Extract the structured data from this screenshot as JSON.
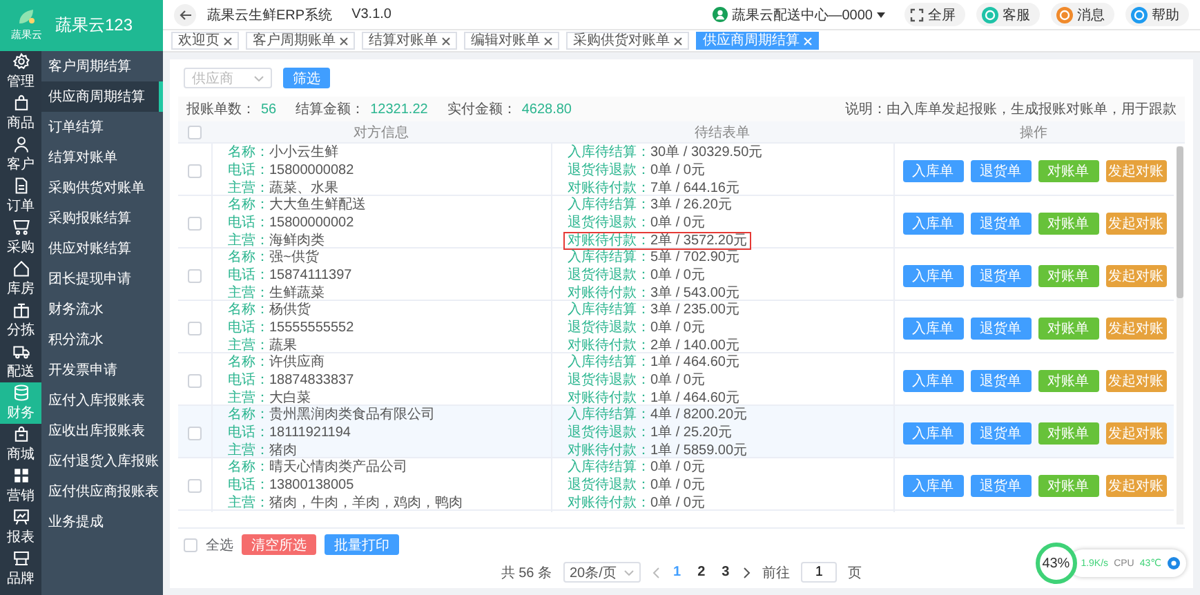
{
  "brand": {
    "logo_text": "蔬果云",
    "name": "蔬果云123"
  },
  "rail": [
    {
      "label": "管理",
      "selected": false
    },
    {
      "label": "商品",
      "selected": false
    },
    {
      "label": "客户",
      "selected": false
    },
    {
      "label": "订单",
      "selected": false
    },
    {
      "label": "采购",
      "selected": false
    },
    {
      "label": "库房",
      "selected": false
    },
    {
      "label": "分拣",
      "selected": false
    },
    {
      "label": "配送",
      "selected": false
    },
    {
      "label": "财务",
      "selected": true
    },
    {
      "label": "商城",
      "selected": false
    },
    {
      "label": "营销",
      "selected": false
    },
    {
      "label": "报表",
      "selected": false
    },
    {
      "label": "品牌",
      "selected": false
    }
  ],
  "submenu": [
    {
      "label": "客户周期结算",
      "selected": false
    },
    {
      "label": "供应商周期结算",
      "selected": true
    },
    {
      "label": "订单结算",
      "selected": false
    },
    {
      "label": "结算对账单",
      "selected": false
    },
    {
      "label": "采购供货对账单",
      "selected": false
    },
    {
      "label": "采购报账结算",
      "selected": false
    },
    {
      "label": "供应对账结算",
      "selected": false
    },
    {
      "label": "团长提现申请",
      "selected": false
    },
    {
      "label": "财务流水",
      "selected": false
    },
    {
      "label": "积分流水",
      "selected": false
    },
    {
      "label": "开发票申请",
      "selected": false
    },
    {
      "label": "应付入库报账表",
      "selected": false
    },
    {
      "label": "应收出库报账表",
      "selected": false
    },
    {
      "label": "应付退货入库报账",
      "selected": false
    },
    {
      "label": "应付供应商报账表",
      "selected": false
    },
    {
      "label": "业务提成",
      "selected": false
    }
  ],
  "header": {
    "title": "蔬果云生鲜ERP系统",
    "version": "V3.1.0",
    "account": "蔬果云配送中心—0000",
    "buttons": [
      {
        "label": "全屏",
        "kind": "plain"
      },
      {
        "label": "客服",
        "kind": "round",
        "color": "#1fc3a8"
      },
      {
        "label": "消息",
        "kind": "round",
        "color": "#f08a2c"
      },
      {
        "label": "帮助",
        "kind": "round",
        "color": "#1e9bf0"
      }
    ]
  },
  "tabs": [
    {
      "label": "欢迎页",
      "selected": false
    },
    {
      "label": "客户周期账单",
      "selected": false
    },
    {
      "label": "结算对账单",
      "selected": false
    },
    {
      "label": "编辑对账单",
      "selected": false
    },
    {
      "label": "采购供货对账单",
      "selected": false
    },
    {
      "label": "供应商周期结算",
      "selected": true
    }
  ],
  "filter": {
    "placeholder": "供应商",
    "button": "筛选"
  },
  "summary": {
    "items": [
      {
        "label": "报账单数：",
        "value": "56"
      },
      {
        "label": "结算金额：",
        "value": "12321.22"
      },
      {
        "label": "实付金额：",
        "value": "4628.80"
      }
    ],
    "note": "说明：由入库单发起报账，生成报账对账单，用于跟款"
  },
  "table": {
    "header_checked": false,
    "columns": [
      "对方信息",
      "待结表单",
      "操作"
    ],
    "rows": [
      {
        "checked": false,
        "highlighted": false,
        "info": [
          {
            "label": "名称：",
            "value": "小小云生鲜"
          },
          {
            "label": "电话：",
            "value": "15800000082"
          },
          {
            "label": "主营：",
            "value": "蔬菜、水果"
          }
        ],
        "pending": [
          {
            "label": "入库待结算：",
            "value": "30单 / 30329.50元",
            "outlined": false
          },
          {
            "label": "退货待退款：",
            "value": "0单 / 0元",
            "outlined": false
          },
          {
            "label": "对账待付款：",
            "value": "7单 / 644.16元",
            "outlined": false
          }
        ],
        "actions": [
          {
            "label": "入库单",
            "color": "#409eff"
          },
          {
            "label": "退货单",
            "color": "#409eff"
          },
          {
            "label": "对账单",
            "color": "#67c23a"
          },
          {
            "label": "发起对账",
            "color": "#e6a23c"
          }
        ]
      },
      {
        "checked": false,
        "highlighted": false,
        "info": [
          {
            "label": "名称：",
            "value": "大大鱼生鲜配送"
          },
          {
            "label": "电话：",
            "value": "15800000002"
          },
          {
            "label": "主营：",
            "value": "海鲜肉类"
          }
        ],
        "pending": [
          {
            "label": "入库待结算：",
            "value": "3单 / 26.20元",
            "outlined": false
          },
          {
            "label": "退货待退款：",
            "value": "0单 / 0元",
            "outlined": false
          },
          {
            "label": "对账待付款：",
            "value": "2单 / 3572.20元",
            "outlined": true
          }
        ],
        "actions": [
          {
            "label": "入库单",
            "color": "#409eff"
          },
          {
            "label": "退货单",
            "color": "#409eff"
          },
          {
            "label": "对账单",
            "color": "#67c23a"
          },
          {
            "label": "发起对账",
            "color": "#e6a23c"
          }
        ]
      },
      {
        "checked": false,
        "highlighted": false,
        "info": [
          {
            "label": "名称：",
            "value": "强~供货"
          },
          {
            "label": "电话：",
            "value": "15874111397"
          },
          {
            "label": "主营：",
            "value": "生鲜蔬菜"
          }
        ],
        "pending": [
          {
            "label": "入库待结算：",
            "value": "5单 / 702.90元",
            "outlined": false
          },
          {
            "label": "退货待退款：",
            "value": "0单 / 0元",
            "outlined": false
          },
          {
            "label": "对账待付款：",
            "value": "3单 / 543.00元",
            "outlined": false
          }
        ],
        "actions": [
          {
            "label": "入库单",
            "color": "#409eff"
          },
          {
            "label": "退货单",
            "color": "#409eff"
          },
          {
            "label": "对账单",
            "color": "#67c23a"
          },
          {
            "label": "发起对账",
            "color": "#e6a23c"
          }
        ]
      },
      {
        "checked": false,
        "highlighted": false,
        "info": [
          {
            "label": "名称：",
            "value": "杨供货"
          },
          {
            "label": "电话：",
            "value": "15555555552"
          },
          {
            "label": "主营：",
            "value": "蔬果"
          }
        ],
        "pending": [
          {
            "label": "入库待结算：",
            "value": "3单 / 235.00元",
            "outlined": false
          },
          {
            "label": "退货待退款：",
            "value": "0单 / 0元",
            "outlined": false
          },
          {
            "label": "对账待付款：",
            "value": "2单 / 140.00元",
            "outlined": false
          }
        ],
        "actions": [
          {
            "label": "入库单",
            "color": "#409eff"
          },
          {
            "label": "退货单",
            "color": "#409eff"
          },
          {
            "label": "对账单",
            "color": "#67c23a"
          },
          {
            "label": "发起对账",
            "color": "#e6a23c"
          }
        ]
      },
      {
        "checked": false,
        "highlighted": false,
        "info": [
          {
            "label": "名称：",
            "value": "许供应商"
          },
          {
            "label": "电话：",
            "value": "18874833837"
          },
          {
            "label": "主营：",
            "value": "大白菜"
          }
        ],
        "pending": [
          {
            "label": "入库待结算：",
            "value": "1单 / 464.60元",
            "outlined": false
          },
          {
            "label": "退货待退款：",
            "value": "0单 / 0元",
            "outlined": false
          },
          {
            "label": "对账待付款：",
            "value": "1单 / 464.60元",
            "outlined": false
          }
        ],
        "actions": [
          {
            "label": "入库单",
            "color": "#409eff"
          },
          {
            "label": "退货单",
            "color": "#409eff"
          },
          {
            "label": "对账单",
            "color": "#67c23a"
          },
          {
            "label": "发起对账",
            "color": "#e6a23c"
          }
        ]
      },
      {
        "checked": false,
        "highlighted": true,
        "info": [
          {
            "label": "名称：",
            "value": "贵州黑润肉类食品有限公司"
          },
          {
            "label": "电话：",
            "value": "18111921194"
          },
          {
            "label": "主营：",
            "value": "猪肉"
          }
        ],
        "pending": [
          {
            "label": "入库待结算：",
            "value": "4单 / 8200.20元",
            "outlined": false
          },
          {
            "label": "退货待退款：",
            "value": "1单 / 25.20元",
            "outlined": false
          },
          {
            "label": "对账待付款：",
            "value": "1单 / 5859.00元",
            "outlined": false
          }
        ],
        "actions": [
          {
            "label": "入库单",
            "color": "#409eff"
          },
          {
            "label": "退货单",
            "color": "#409eff"
          },
          {
            "label": "对账单",
            "color": "#67c23a"
          },
          {
            "label": "发起对账",
            "color": "#e6a23c"
          }
        ]
      },
      {
        "checked": false,
        "highlighted": false,
        "info": [
          {
            "label": "名称：",
            "value": "晴天心情肉类产品公司"
          },
          {
            "label": "电话：",
            "value": "13800138005"
          },
          {
            "label": "主营：",
            "value": "猪肉，牛肉，羊肉，鸡肉，鸭肉"
          }
        ],
        "pending": [
          {
            "label": "入库待结算：",
            "value": "0单 / 0元",
            "outlined": false
          },
          {
            "label": "退货待退款：",
            "value": "0单 / 0元",
            "outlined": false
          },
          {
            "label": "对账待付款：",
            "value": "0单 / 0元",
            "outlined": false
          }
        ],
        "actions": [
          {
            "label": "入库单",
            "color": "#409eff"
          },
          {
            "label": "退货单",
            "color": "#409eff"
          },
          {
            "label": "对账单",
            "color": "#67c23a"
          },
          {
            "label": "发起对账",
            "color": "#e6a23c"
          }
        ]
      }
    ]
  },
  "footer": {
    "select_all": {
      "label": "全选",
      "checked": false
    },
    "buttons": [
      {
        "label": "清空所选",
        "color": "#f56c6c"
      },
      {
        "label": "批量打印",
        "color": "#409eff"
      }
    ],
    "pagination": {
      "total": "共 56 条",
      "page_size": "20条/页",
      "pages": [
        {
          "label": "1",
          "selected": true
        },
        {
          "label": "2",
          "selected": false
        },
        {
          "label": "3",
          "selected": false
        }
      ],
      "goto_label": "前往",
      "goto_value": "1",
      "goto_suffix": "页"
    }
  },
  "monitor": {
    "percent": "43%",
    "speed": "1.9K/s",
    "cpu_label": "CPU",
    "cpu_temp": "43℃"
  }
}
